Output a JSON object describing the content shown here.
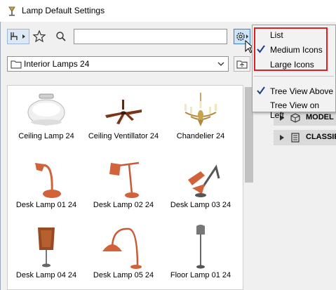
{
  "window": {
    "title": "Lamp Default Settings"
  },
  "search": {
    "value": "",
    "placeholder": ""
  },
  "folder": {
    "selected": "Interior Lamps 24"
  },
  "items": [
    {
      "label": "Ceiling Lamp 24"
    },
    {
      "label": "Ceiling Ventillator 24"
    },
    {
      "label": "Chandelier 24"
    },
    {
      "label": "Desk Lamp 01 24"
    },
    {
      "label": "Desk Lamp 02 24"
    },
    {
      "label": "Desk Lamp 03 24"
    },
    {
      "label": "Desk Lamp 04 24"
    },
    {
      "label": "Desk Lamp 05 24"
    },
    {
      "label": "Floor Lamp 01 24"
    }
  ],
  "menu": {
    "items": [
      {
        "label": "List",
        "checked": false
      },
      {
        "label": "Medium Icons",
        "checked": true
      },
      {
        "label": "Large Icons",
        "checked": false
      },
      {
        "label": "Tree View Above",
        "checked": true
      },
      {
        "label": "Tree View on Left",
        "checked": false
      }
    ]
  },
  "panel": {
    "sections": [
      {
        "label": "MODEL"
      },
      {
        "label": "CLASSIF"
      }
    ]
  },
  "colors": {
    "accent": "#3f7fc3",
    "highlight_border": "#e02020",
    "lamp_orange": "#d2623a"
  }
}
